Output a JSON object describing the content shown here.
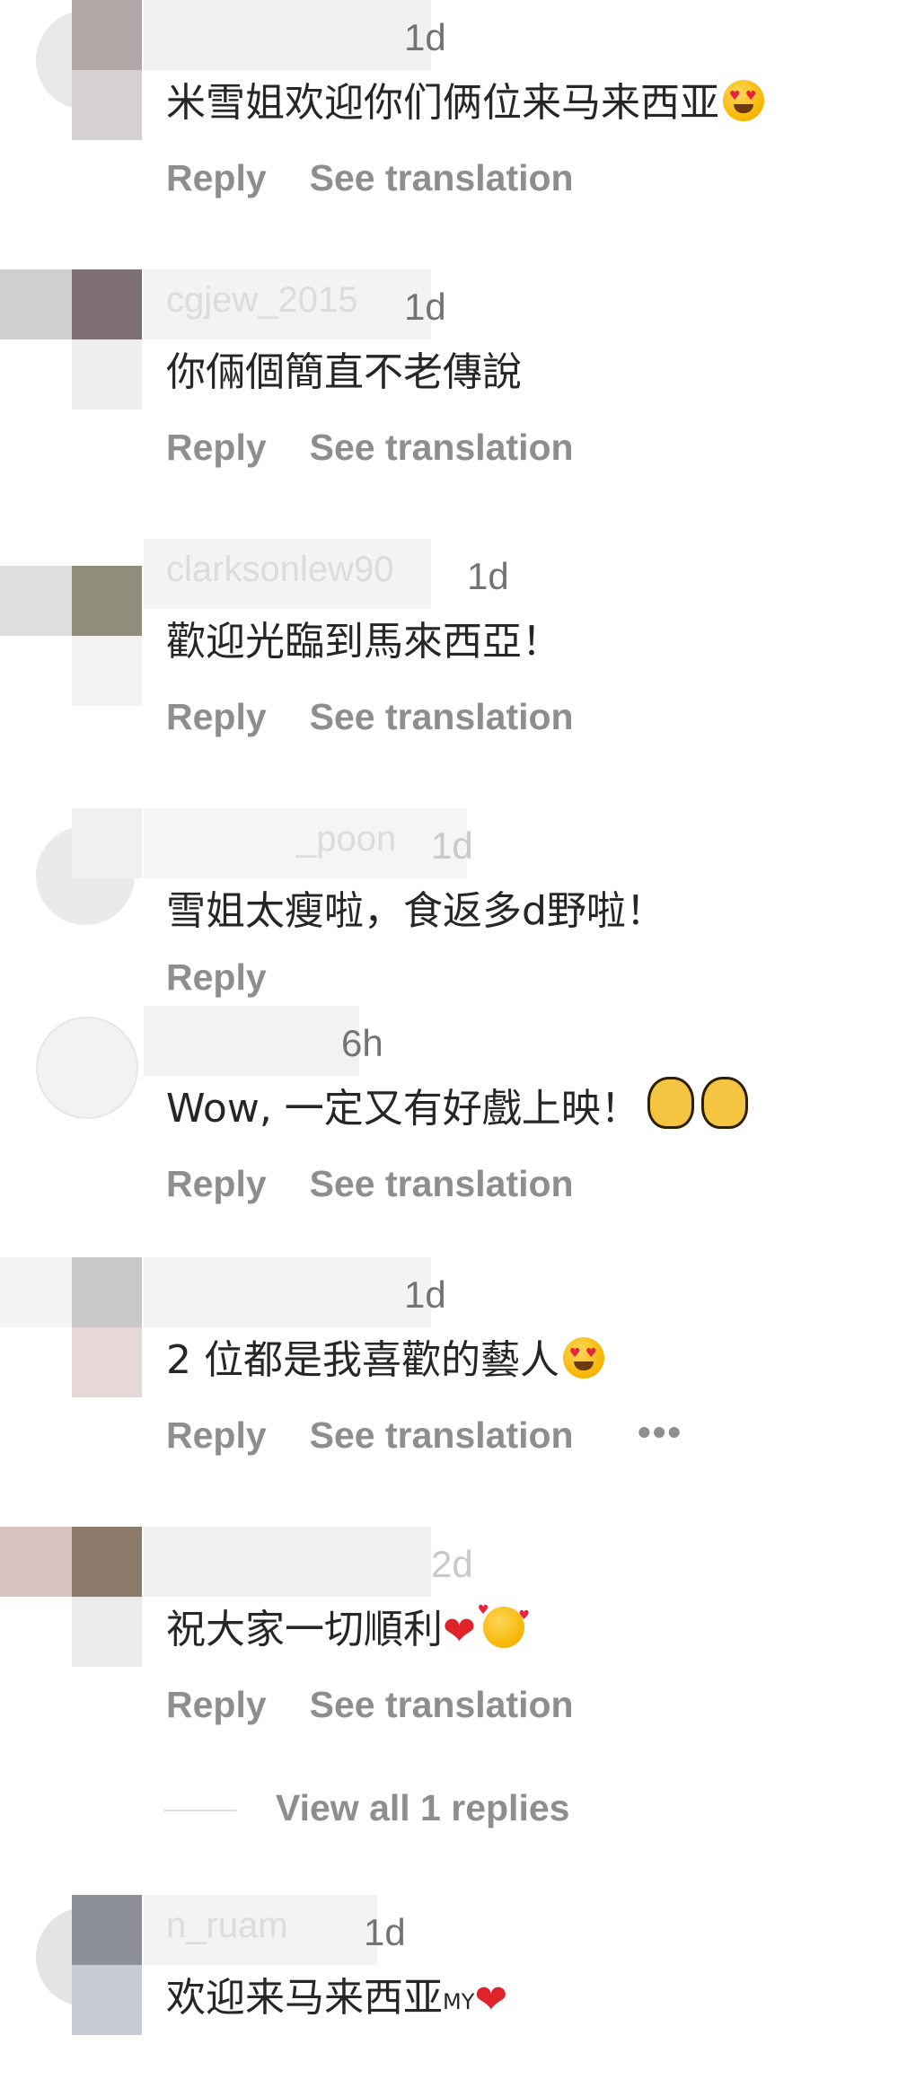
{
  "colors": {
    "text": "#262626",
    "secondary": "#8e8e8e",
    "time": "#737373",
    "heart": "#e0222a"
  },
  "labels": {
    "reply": "Reply",
    "see_translation": "See translation",
    "more": "•••",
    "view_all_replies": "View all 1 replies"
  },
  "comments": [
    {
      "username": "",
      "time": "1d",
      "text": "米雪姐欢迎你们俩位来马来西亚",
      "emoji": "heart-eyes-icon"
    },
    {
      "username": "cgjew_2015",
      "time": "1d",
      "text": "你倆個簡直不老傳說",
      "emoji": ""
    },
    {
      "username": "clarksonlew90",
      "time": "1d",
      "text": "歡迎光臨到馬來西亞！",
      "emoji": ""
    },
    {
      "username": "_poon",
      "time": "1d",
      "text": "雪姐太瘦啦，食返多d野啦！",
      "emoji": ""
    },
    {
      "username": "",
      "time": "6h",
      "text": "Wow, 一定又有好戲上映！",
      "emoji": "clapping-hands-icon"
    },
    {
      "username": "",
      "time": "1d",
      "text": "2 位都是我喜歡的藝人",
      "emoji": "heart-eyes-icon"
    },
    {
      "username": "",
      "time": "2d",
      "text": "祝大家一切順利",
      "emoji": "red-heart-icon"
    },
    {
      "username": "n_ruam",
      "time": "1d",
      "text": "欢迎来马来西亚",
      "suffix": "MY",
      "emoji": "red-heart-icon"
    }
  ]
}
